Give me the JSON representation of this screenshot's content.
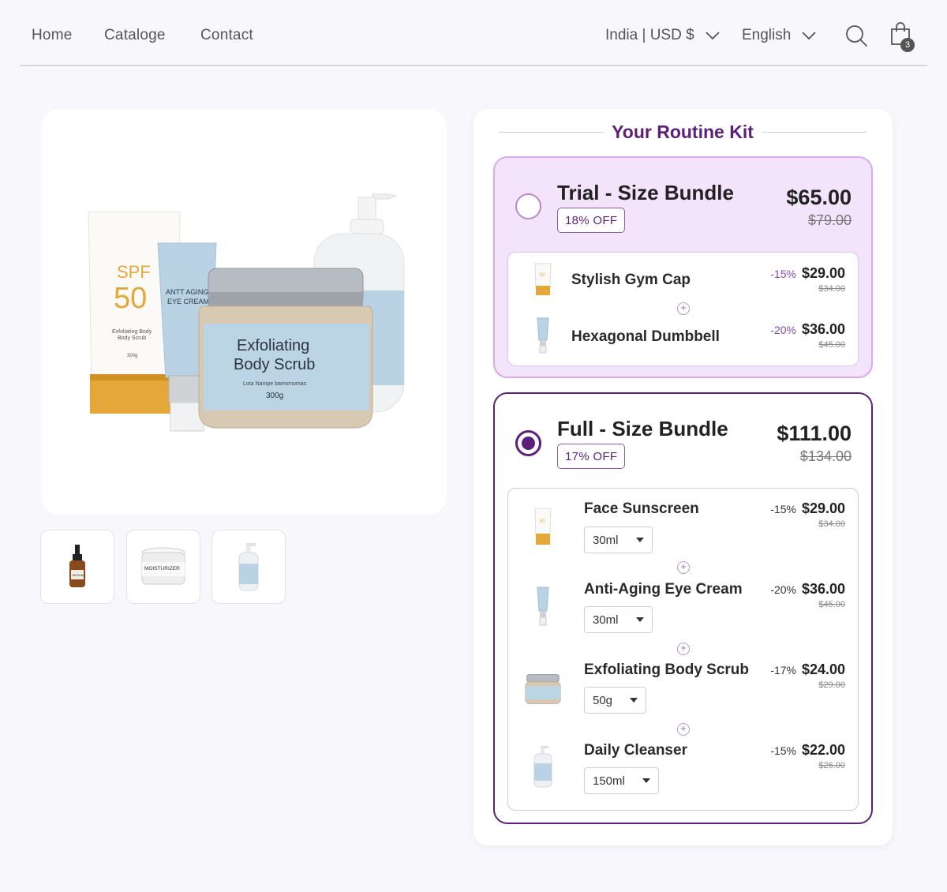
{
  "nav": {
    "home": "Home",
    "catalogue": "Cataloge",
    "contact": "Contact",
    "region": "India | USD $",
    "language": "English",
    "cart_count": "3"
  },
  "gallery": {
    "scrub_line1": "Exfoliating",
    "scrub_line2": "Body Scrub",
    "scrub_sub": "Lota Nampe bamsmomas",
    "scrub_weight": "300g",
    "spf_label": "SPF",
    "spf_value": "50",
    "spf_sub1": "Exfoliating Body",
    "spf_sub2": "Body Scrub",
    "spf_weight": "300g",
    "eye_line1": "ANTT AGING",
    "eye_line2": "EYE CREAM",
    "thumb_serum": "SERUM",
    "thumb_moist": "MOISTURIZER"
  },
  "kit": {
    "title": "Your Routine Kit",
    "trial": {
      "name": "Trial - Size Bundle",
      "off": "18% OFF",
      "price": "$65.00",
      "was": "$79.00",
      "items": [
        {
          "name": "Stylish Gym Cap",
          "disc": "-15%",
          "price": "$29.00",
          "was": "$34.00"
        },
        {
          "name": "Hexagonal Dumbbell",
          "disc": "-20%",
          "price": "$36.00",
          "was": "$45.00"
        }
      ]
    },
    "full": {
      "name": "Full - Size Bundle",
      "off": "17% OFF",
      "price": "$111.00",
      "was": "$134.00",
      "items": [
        {
          "name": "Face Sunscreen",
          "disc": "-15%",
          "price": "$29.00",
          "was": "$34.00",
          "variant": "30ml"
        },
        {
          "name": "Anti-Aging Eye Cream",
          "disc": "-20%",
          "price": "$36.00",
          "was": "$45.00",
          "variant": "30ml"
        },
        {
          "name": "Exfoliating Body Scrub",
          "disc": "-17%",
          "price": "$24.00",
          "was": "$29.00",
          "variant": "50g"
        },
        {
          "name": "Daily Cleanser",
          "disc": "-15%",
          "price": "$22.00",
          "was": "$26.00",
          "variant": "150ml"
        }
      ]
    }
  },
  "colors": {
    "accent": "#5d1f7a",
    "trial_bg": "#f3e3fb",
    "product_blue": "#b9d3e4",
    "product_orange": "#e5a63a"
  }
}
